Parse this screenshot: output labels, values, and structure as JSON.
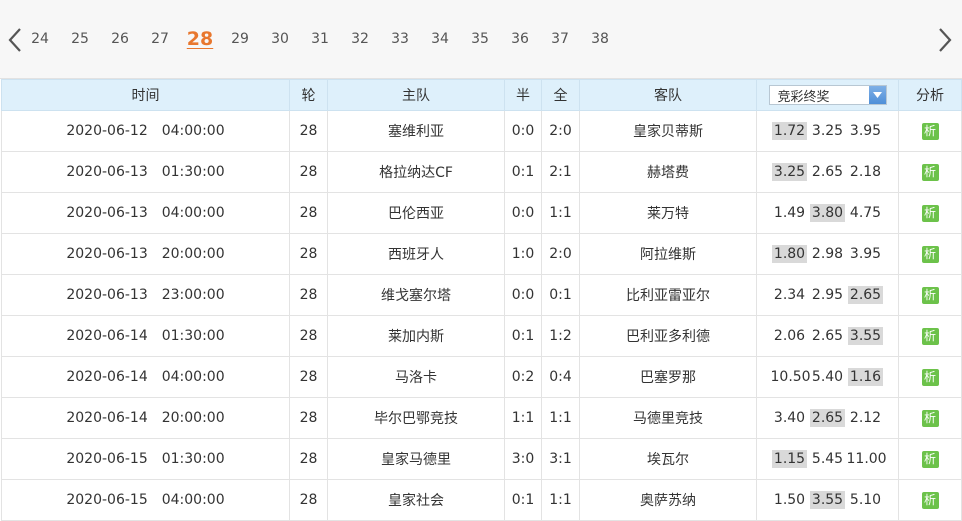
{
  "rounds": [
    "24",
    "25",
    "26",
    "27",
    "28",
    "29",
    "30",
    "31",
    "32",
    "33",
    "34",
    "35",
    "36",
    "37",
    "38"
  ],
  "active_round": "28",
  "headers": {
    "time": "时间",
    "round": "轮",
    "home": "主队",
    "half": "半",
    "full": "全",
    "away": "客队",
    "odds_select": "竞彩终奖",
    "analysis": "分析"
  },
  "analysis_label": "析",
  "rows": [
    {
      "date": "2020-06-12",
      "time": "04:00:00",
      "round": "28",
      "home": "塞维利亚",
      "half": "0:0",
      "full": "2:0",
      "away": "皇家贝蒂斯",
      "odds": [
        "1.72",
        "3.25",
        "3.95"
      ],
      "hl": 0
    },
    {
      "date": "2020-06-13",
      "time": "01:30:00",
      "round": "28",
      "home": "格拉纳达CF",
      "half": "0:1",
      "full": "2:1",
      "away": "赫塔费",
      "odds": [
        "3.25",
        "2.65",
        "2.18"
      ],
      "hl": 0
    },
    {
      "date": "2020-06-13",
      "time": "04:00:00",
      "round": "28",
      "home": "巴伦西亚",
      "half": "0:0",
      "full": "1:1",
      "away": "莱万特",
      "odds": [
        "1.49",
        "3.80",
        "4.75"
      ],
      "hl": 1
    },
    {
      "date": "2020-06-13",
      "time": "20:00:00",
      "round": "28",
      "home": "西班牙人",
      "half": "1:0",
      "full": "2:0",
      "away": "阿拉维斯",
      "odds": [
        "1.80",
        "2.98",
        "3.95"
      ],
      "hl": 0
    },
    {
      "date": "2020-06-13",
      "time": "23:00:00",
      "round": "28",
      "home": "维戈塞尔塔",
      "half": "0:0",
      "full": "0:1",
      "away": "比利亚雷亚尔",
      "odds": [
        "2.34",
        "2.95",
        "2.65"
      ],
      "hl": 2
    },
    {
      "date": "2020-06-14",
      "time": "01:30:00",
      "round": "28",
      "home": "莱加内斯",
      "half": "0:1",
      "full": "1:2",
      "away": "巴利亚多利德",
      "odds": [
        "2.06",
        "2.65",
        "3.55"
      ],
      "hl": 2
    },
    {
      "date": "2020-06-14",
      "time": "04:00:00",
      "round": "28",
      "home": "马洛卡",
      "half": "0:2",
      "full": "0:4",
      "away": "巴塞罗那",
      "odds": [
        "10.50",
        "5.40",
        "1.16"
      ],
      "hl": 2
    },
    {
      "date": "2020-06-14",
      "time": "20:00:00",
      "round": "28",
      "home": "毕尔巴鄂竞技",
      "half": "1:1",
      "full": "1:1",
      "away": "马德里竞技",
      "odds": [
        "3.40",
        "2.65",
        "2.12"
      ],
      "hl": 1
    },
    {
      "date": "2020-06-15",
      "time": "01:30:00",
      "round": "28",
      "home": "皇家马德里",
      "half": "3:0",
      "full": "3:1",
      "away": "埃瓦尔",
      "odds": [
        "1.15",
        "5.45",
        "11.00"
      ],
      "hl": 0
    },
    {
      "date": "2020-06-15",
      "time": "04:00:00",
      "round": "28",
      "home": "皇家社会",
      "half": "0:1",
      "full": "1:1",
      "away": "奥萨苏纳",
      "odds": [
        "1.50",
        "3.55",
        "5.10"
      ],
      "hl": 1
    }
  ]
}
